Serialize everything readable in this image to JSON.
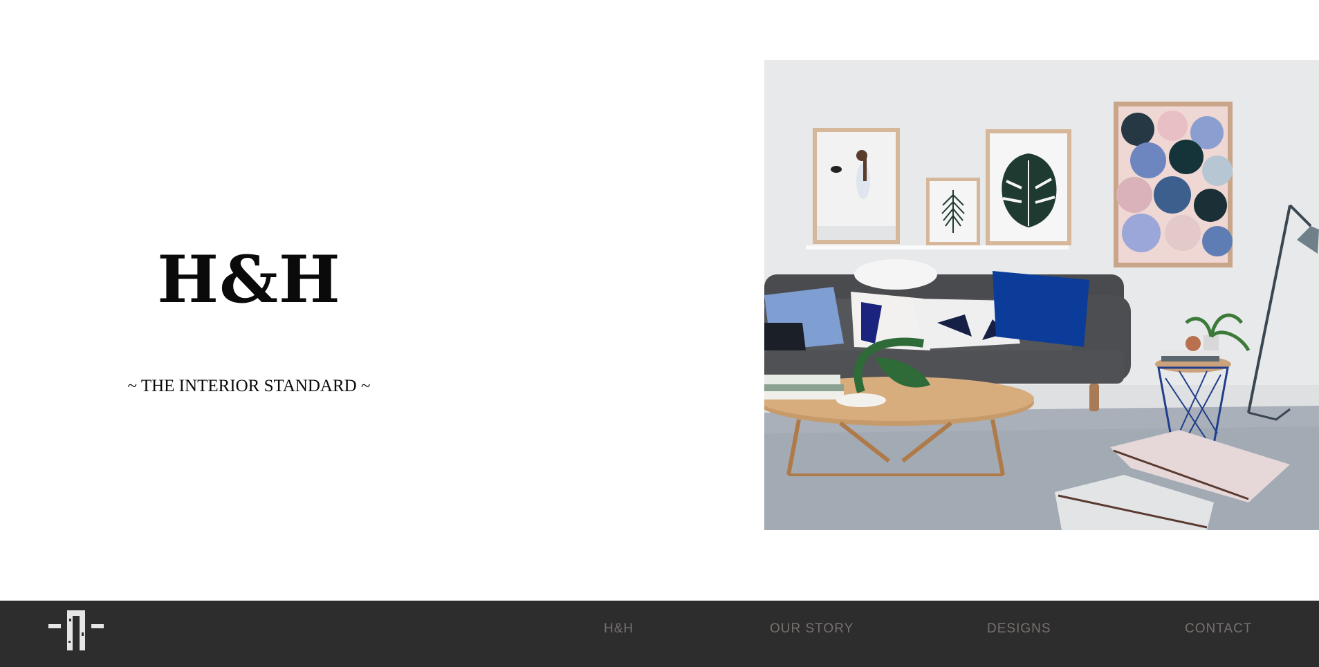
{
  "hero": {
    "title": "H&H",
    "tagline": "~ THE INTERIOR STANDARD ~",
    "image_alt": "Living room with grey sofa, cushions, framed prints, coffee table and floor lamp"
  },
  "footer": {
    "logo_icon": "brand-logo-icon",
    "nav": [
      {
        "label": "H&H"
      },
      {
        "label": "OUR STORY"
      },
      {
        "label": "DESIGNS"
      },
      {
        "label": "CONTACT"
      }
    ]
  },
  "colors": {
    "footer_bg": "#2d2d2d",
    "nav_text": "#77706f",
    "title_text": "#0a0a0a",
    "page_bg": "#ffffff"
  }
}
